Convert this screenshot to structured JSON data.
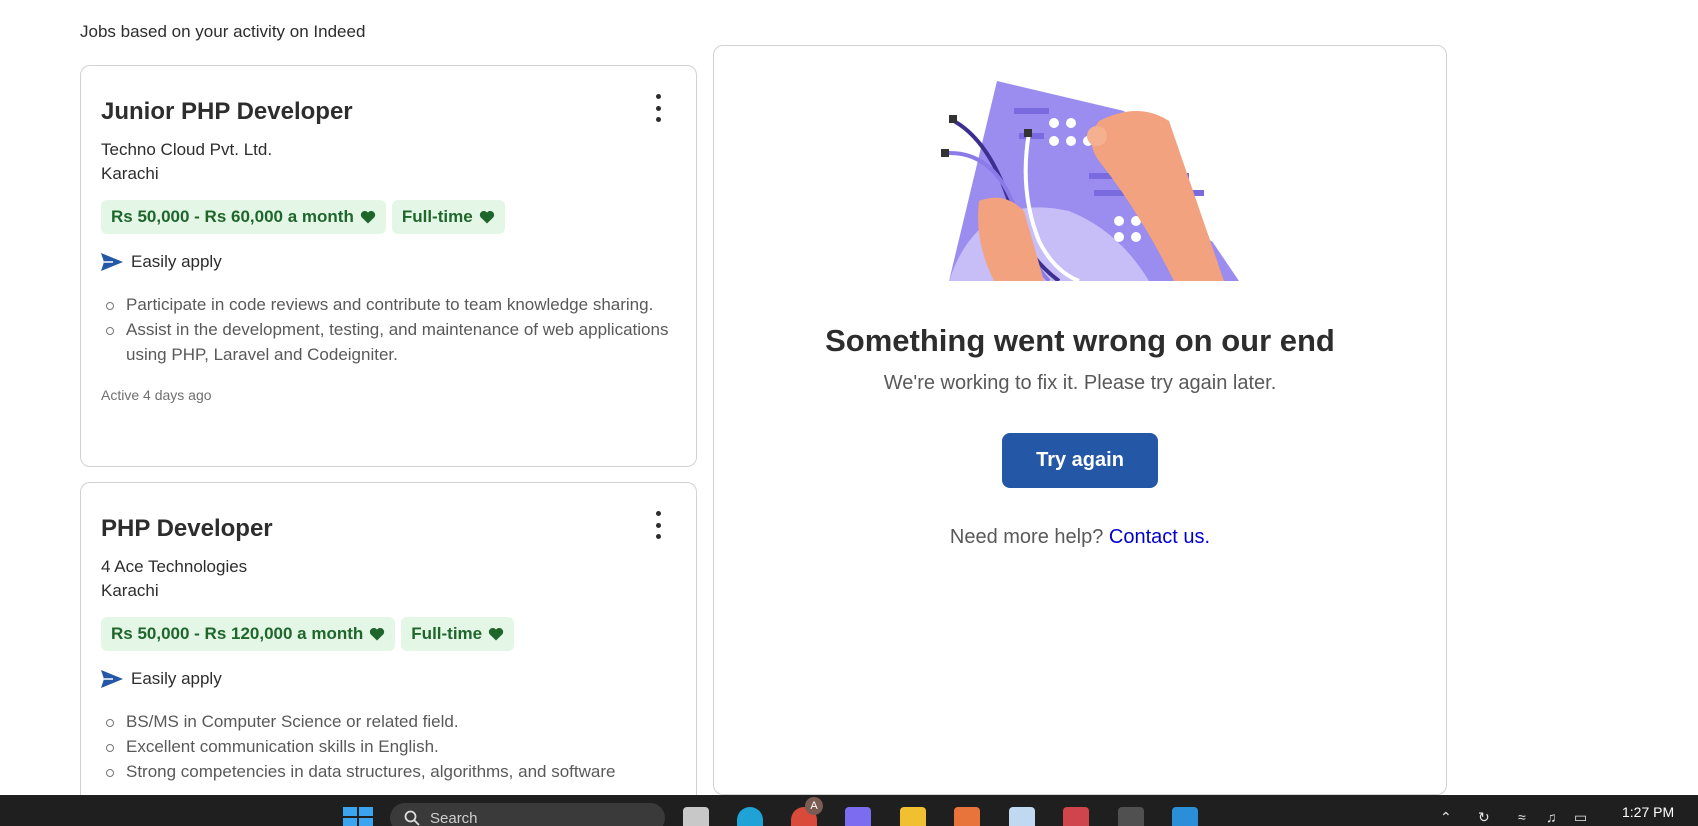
{
  "section_heading": "Jobs based on your activity on Indeed",
  "jobs": [
    {
      "title": "Junior PHP Developer",
      "company": "Techno Cloud Pvt. Ltd.",
      "location": "Karachi",
      "salary": "Rs 50,000 - Rs 60,000 a month",
      "job_type": "Full-time",
      "easily_apply": "Easily apply",
      "bullets": [
        "Participate in code reviews and contribute to team knowledge sharing.",
        "Assist in the development, testing, and maintenance of web applications using PHP, Laravel and Codeigniter."
      ],
      "active": "Active 4 days ago"
    },
    {
      "title": "PHP Developer",
      "company": "4 Ace Technologies",
      "location": "Karachi",
      "salary": "Rs 50,000 - Rs 120,000 a month",
      "job_type": "Full-time",
      "easily_apply": "Easily apply",
      "bullets": [
        "BS/MS in Computer Science or related field.",
        "Excellent communication skills in English.",
        "Strong competencies in data structures, algorithms, and software"
      ]
    }
  ],
  "error_panel": {
    "title": "Something went wrong on our end",
    "subtitle": "We're working to fix it. Please try again later.",
    "button": "Try again",
    "help_text": "Need more help?",
    "help_link": "Contact us."
  },
  "taskbar": {
    "search_placeholder": "Search",
    "clock": "1:27 PM",
    "chrome_badge": "A"
  },
  "colors": {
    "accent": "#2557a7",
    "tag_bg": "#e4f7e6",
    "tag_text": "#1f662c",
    "link": "#0000cc"
  }
}
